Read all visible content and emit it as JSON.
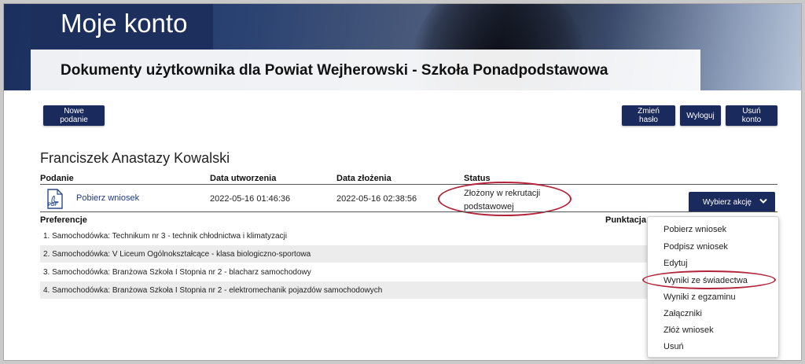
{
  "page": {
    "title": "Moje konto",
    "subtitle": "Dokumenty użytkownika dla Powiat Wejherowski - Szkoła Ponadpodstawowa"
  },
  "toolbar": {
    "new_application": "Nowe podanie",
    "change_password": "Zmień hasło",
    "logout": "Wyloguj",
    "delete_account": "Usuń konto"
  },
  "user": {
    "name": "Franciszek Anastazy Kowalski"
  },
  "table": {
    "headers": {
      "application": "Podanie",
      "created": "Data utworzenia",
      "submitted": "Data złożenia",
      "status": "Status"
    },
    "row": {
      "download": "Pobierz wniosek",
      "created": "2022-05-16 01:46:36",
      "submitted": "2022-05-16 02:38:56",
      "status": "Złożony w rekrutacji podstawowej",
      "action": "Wybierz akcję"
    },
    "pdf_label": "PDF"
  },
  "preferences": {
    "header": "Preferencje",
    "score_header": "Punktacja",
    "items": [
      "1. Samochodówka: Technikum nr 3 - technik chłodnictwa i klimatyzacji",
      "2. Samochodówka: V Liceum Ogólnokształcące - klasa biologiczno-sportowa",
      "3. Samochodówka: Branżowa Szkoła I Stopnia nr 2 - blacharz samochodowy",
      "4. Samochodówka: Branżowa Szkoła I Stopnia nr 2 - elektromechanik pojazdów samochodowych"
    ]
  },
  "dropdown": {
    "items": [
      "Pobierz wniosek",
      "Podpisz wniosek",
      "Edytuj",
      "Wyniki ze świadectwa",
      "Wyniki z egzaminu",
      "Załączniki",
      "Złóż wniosek",
      "Usuń"
    ]
  },
  "colors": {
    "brand": "#1b2a5c",
    "highlight": "#b3243a"
  }
}
